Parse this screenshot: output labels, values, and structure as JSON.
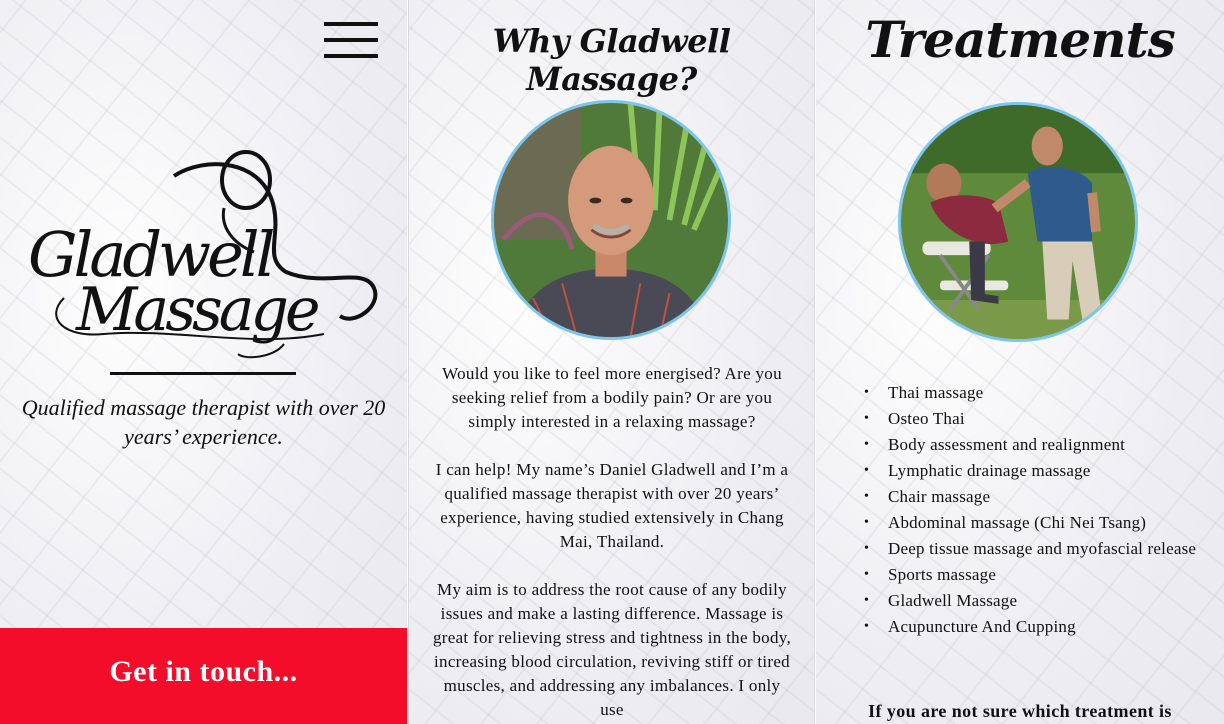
{
  "hero": {
    "menu_icon": "hamburger-menu-icon",
    "logo_text": "Gladwell Massage",
    "tagline": "Qualified massage therapist with over 20 years’ experience.",
    "cta_label": "Get in touch..."
  },
  "why": {
    "title": "Why Gladwell Massage?",
    "paragraphs": [
      "Would you like to feel more energised? Are you seeking relief from a bodily pain? Or are you simply interested in a relaxing massage?",
      "I can help! My name’s Daniel Gladwell and I’m a qualified massage therapist with over 20 years’ experience, having studied extensively in Chang Mai, Thailand.",
      "My aim is to address the root cause of any bodily issues and make a lasting difference. Massage is great for relieving stress and tightness in the body, increasing blood circulation, reviving stiff or tired muscles, and addressing any imbalances. I only use"
    ]
  },
  "treatments": {
    "title": "Treatments",
    "items": [
      "Thai massage",
      "Osteo Thai",
      "Body assessment and realignment",
      "Lymphatic drainage massage",
      "Chair massage",
      "Abdominal massage (Chi Nei Tsang)",
      "Deep tissue massage and myofascial release",
      "Sports massage",
      "Gladwell Massage",
      "Acupuncture And Cupping"
    ],
    "note": "If you are not sure which treatment is"
  },
  "colors": {
    "cta_red": "#f40d2a",
    "portrait_ring": "#7cc6ee",
    "text": "#111111"
  }
}
